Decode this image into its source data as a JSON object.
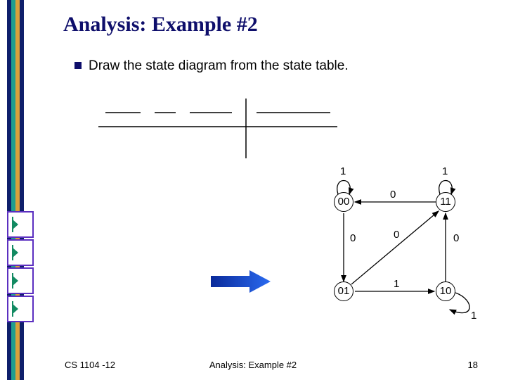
{
  "title": "Analysis: Example #2",
  "bullet": "Draw the state diagram from the state table.",
  "states": {
    "s00": "00",
    "s11": "11",
    "s01": "01",
    "s10": "10"
  },
  "edge_labels": {
    "loop00": "1",
    "loop11": "1",
    "loop10": "1",
    "e11_00": "0",
    "e00_01": "0",
    "e01_11": "0",
    "e10_11": "0",
    "e01_10": "1"
  },
  "footer": {
    "left": "CS 1104 -12",
    "center": "Analysis: Example #2",
    "right": "18"
  },
  "chart_data": {
    "type": "state_diagram",
    "states": [
      "00",
      "01",
      "10",
      "11"
    ],
    "transitions": [
      {
        "from": "00",
        "input": "1",
        "to": "00"
      },
      {
        "from": "11",
        "input": "1",
        "to": "11"
      },
      {
        "from": "10",
        "input": "1",
        "to": "10"
      },
      {
        "from": "11",
        "input": "0",
        "to": "00"
      },
      {
        "from": "00",
        "input": "0",
        "to": "01"
      },
      {
        "from": "01",
        "input": "0",
        "to": "11"
      },
      {
        "from": "10",
        "input": "0",
        "to": "11"
      },
      {
        "from": "01",
        "input": "1",
        "to": "10"
      }
    ]
  }
}
